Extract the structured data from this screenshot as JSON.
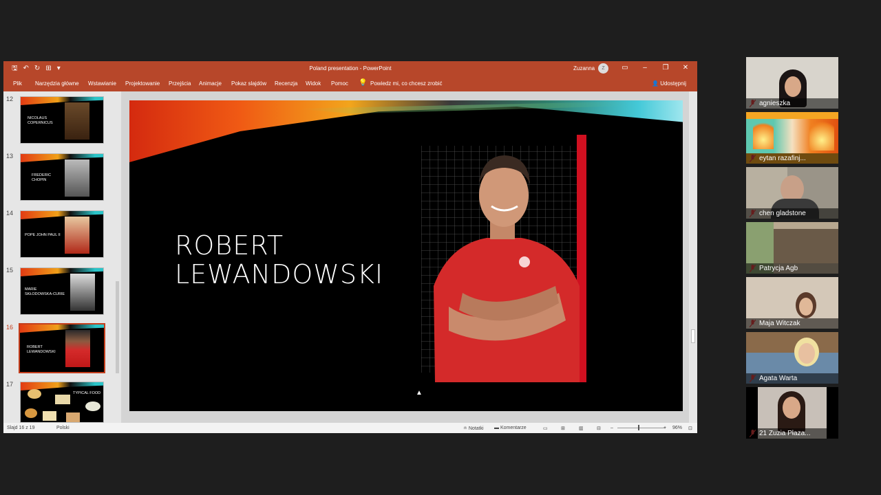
{
  "app": {
    "title": "Poland presentation  -  PowerPoint",
    "user": "Zuzanna",
    "user_initial": "Z",
    "share": "Udostępnij"
  },
  "ribbon": {
    "tabs": [
      "Plik",
      "Narzędzia główne",
      "Wstawianie",
      "Projektowanie",
      "Przejścia",
      "Animacje",
      "Pokaz slajdów",
      "Recenzja",
      "Widok",
      "Pomoc"
    ],
    "tell_me": "Powiedz mi, co chcesz zrobić"
  },
  "thumbnails": [
    {
      "num": "12",
      "text": "Nicolaus\nCopernicus"
    },
    {
      "num": "13",
      "text": "Frederic\nChopin"
    },
    {
      "num": "14",
      "text": "Pope John Paul II"
    },
    {
      "num": "15",
      "text": "Marie\nSkłodowska-Curie"
    },
    {
      "num": "16",
      "text": "Robert\nLewandowski",
      "active": true
    },
    {
      "num": "17",
      "text": "Typical food"
    }
  ],
  "slide": {
    "title": "ROBERT\nLEWANDOWSKI"
  },
  "status": {
    "slide_counter": "Slajd 16 z 19",
    "language": "Polski",
    "notes": "Notatki",
    "comments": "Komentarze",
    "zoom": "96%"
  },
  "participants": [
    {
      "name": "agnieszka",
      "bg": "#d8d4cc"
    },
    {
      "name": "eytan razafinj...",
      "bg": "#f5a623"
    },
    {
      "name": "chen gladstone",
      "bg": "#9a9488"
    },
    {
      "name": "Patrycja Agb",
      "bg": "#b8a890"
    },
    {
      "name": "Maja Witczak",
      "bg": "#d4c8b8"
    },
    {
      "name": "Agata Warta",
      "bg": "#6a8aa8"
    },
    {
      "name": "21 Zuzia Płaza...",
      "bg": "#000000"
    }
  ],
  "colors": {
    "accent": "#b7472a",
    "active_thumb": "#c43e1c"
  }
}
